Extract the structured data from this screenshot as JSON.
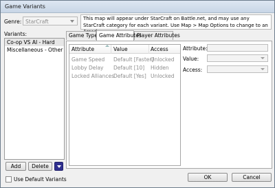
{
  "window": {
    "title": "Game Variants"
  },
  "genre": {
    "label": "Genre:",
    "value": "StarCraft"
  },
  "description": "This map will appear under StarCraft on Battle.net, and may use any StarCraft category for each variant. Use Map > Map Options to change to an Arcade map.",
  "variants": {
    "label": "Variants:",
    "items": [
      "Co-op VS AI - Hard",
      "Miscellaneous - Other"
    ],
    "add_label": "Add",
    "delete_label": "Delete",
    "use_default_label": "Use Default Variants"
  },
  "tabs": [
    "Game Type",
    "Game Attributes",
    "Player Attributes"
  ],
  "attributes": {
    "columns": [
      "Attribute",
      "Value",
      "Access"
    ],
    "rows": [
      [
        "Game Speed",
        "Default [Faster]",
        "Unlocked"
      ],
      [
        "Lobby Delay",
        "Default [10]",
        "Hidden"
      ],
      [
        "Locked Alliances",
        "Default [Yes]",
        "Unlocked"
      ]
    ]
  },
  "details": {
    "attribute_label": "Attribute:",
    "value_label": "Value:",
    "access_label": "Access:"
  },
  "buttons": {
    "ok": "OK",
    "cancel": "Cancel"
  }
}
